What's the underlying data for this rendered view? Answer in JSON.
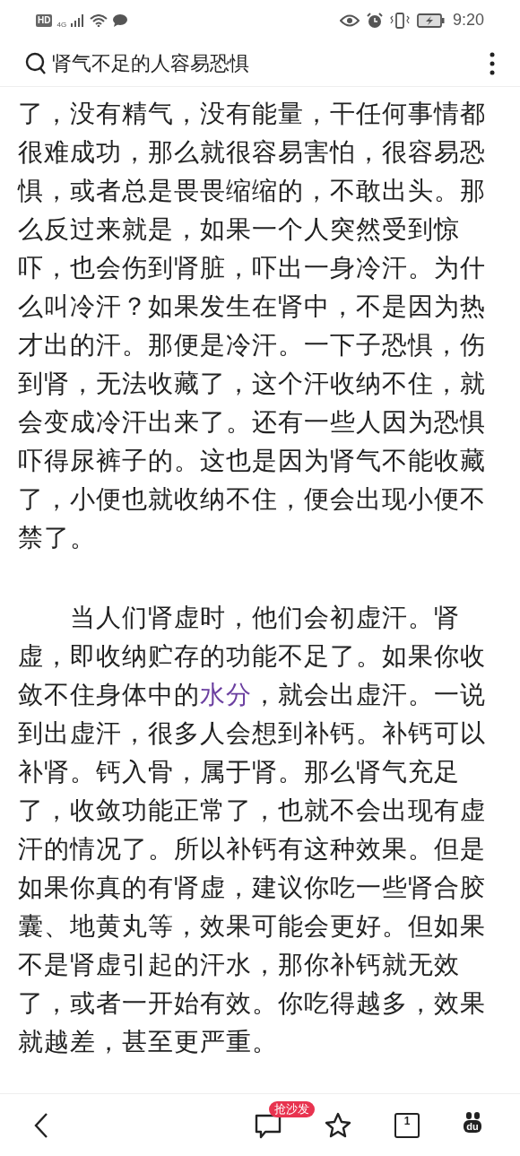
{
  "status_bar": {
    "network_badge": "HD",
    "network_type": "4G",
    "time": "9:20"
  },
  "search_bar": {
    "query": "肾气不足的人容易恐惧"
  },
  "article": {
    "paragraphs": [
      {
        "indent": false,
        "parts": [
          {
            "kind": "text",
            "text": "了，没有精气，没有能量，干任何事情都很难成功，那么就很容易害怕，很容易恐惧，或者总是畏畏缩缩的，不敢出头。那么反过来就是，如果一个人突然受到惊吓，也会伤到肾脏，吓出一身冷汗。为什么叫冷汗？如果发生在肾中，不是因为热才出的汗。那便是冷汗。一下子恐惧，伤到肾，无法收藏了，这个汗收纳不住，就会变成冷汗出来了。还有一些人因为恐惧吓得尿裤子的。这也是因为肾气不能收藏了，小便也就收纳不住，便会出现小便不禁了。"
          }
        ]
      },
      {
        "indent": true,
        "parts": [
          {
            "kind": "text",
            "text": "当人们肾虚时，他们会初虚汗。肾虚，即收纳贮存的功能不足了。如果你收敛不住身体中的"
          },
          {
            "kind": "link",
            "text": "水分"
          },
          {
            "kind": "text",
            "text": "，就会出虚汗。一说到出虚汗，很多人会想到补钙。补钙可以补肾。钙入骨，属于肾。那么肾气充足了，收敛功能正常了，也就不会出现有虚汗的情况了。所以补钙有这种效果。但是如果你真的有肾虚，建议你吃一些肾合胶囊、地黄丸等，效果可能会更好。但如果不是肾虚引起的汗水，那你补钙就无效了，或者一开始有效。你吃得越多，效果就越差，甚至更严重。"
          }
        ]
      }
    ]
  },
  "bottom_bar": {
    "comment_badge": "抢沙发",
    "tab_count": "1",
    "logo_text": "du"
  }
}
